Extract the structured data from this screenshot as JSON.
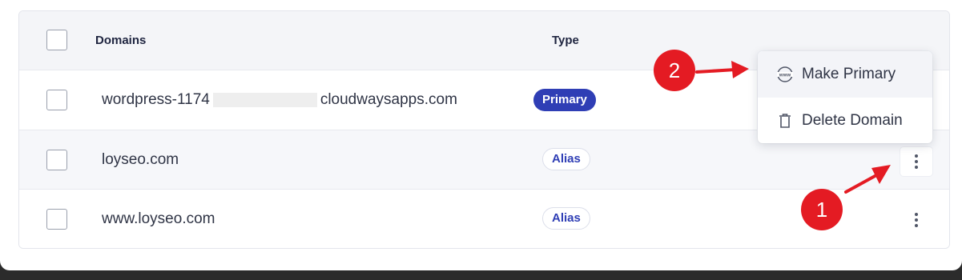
{
  "table": {
    "headers": {
      "domains": "Domains",
      "type": "Type"
    },
    "rows": [
      {
        "domain_prefix": "wordpress-1174",
        "domain_suffix": "cloudwaysapps.com",
        "type": "Primary"
      },
      {
        "domain": "loyseo.com",
        "type": "Alias"
      },
      {
        "domain": "www.loyseo.com",
        "type": "Alias"
      }
    ]
  },
  "menu": {
    "items": [
      {
        "label": "Make Primary",
        "icon": "www-globe-icon"
      },
      {
        "label": "Delete Domain",
        "icon": "trash-icon"
      }
    ]
  },
  "annotations": {
    "markers": [
      "1",
      "2"
    ],
    "color": "#e41b23"
  },
  "colors": {
    "primary_badge": "#2f3eb5",
    "alias_text": "#2f3eb5"
  }
}
